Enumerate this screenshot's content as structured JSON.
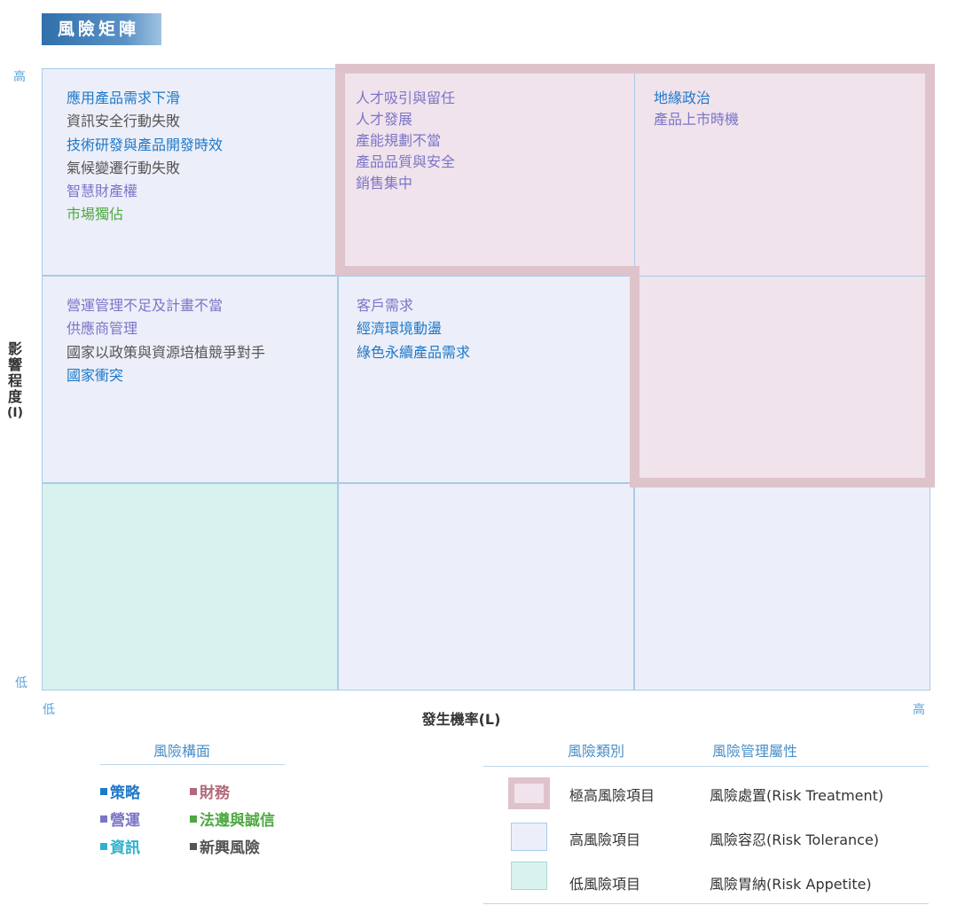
{
  "title": "風險矩陣",
  "axes": {
    "y_high": "高",
    "y_low": "低",
    "y_title_chars": [
      "影",
      "響",
      "程",
      "度",
      "(I)"
    ],
    "x_low": "低",
    "x_high": "高",
    "x_title": "發生機率(L)"
  },
  "colors": {
    "strategy": "#1f78c8",
    "finance": "#b2697a",
    "operations": "#7b75c8",
    "compliance": "#4ea843",
    "information": "#2eb2cc",
    "emerging": "#555555",
    "extreme_fill": "#f0e3ec",
    "extreme_border": "#dfc3cb",
    "high_fill": "#eceff9",
    "low_fill": "#d8f3ee"
  },
  "matrix": {
    "r0c0": [
      {
        "text": "應用產品需求下滑",
        "cat": "strategy"
      },
      {
        "text": "資訊安全行動失敗",
        "cat": "emerging"
      },
      {
        "text": "技術研發與產品開發時效",
        "cat": "strategy"
      },
      {
        "text": "氣候變遷行動失敗",
        "cat": "emerging"
      },
      {
        "text": "智慧財產權",
        "cat": "operations"
      },
      {
        "text": "市場獨佔",
        "cat": "compliance"
      }
    ],
    "r0c1": [
      {
        "text": "人才吸引與留任",
        "cat": "operations"
      },
      {
        "text": "人才發展",
        "cat": "operations"
      },
      {
        "text": "產能規劃不當",
        "cat": "operations"
      },
      {
        "text": "產品品質與安全",
        "cat": "operations"
      },
      {
        "text": "銷售集中",
        "cat": "operations"
      }
    ],
    "r0c2": [
      {
        "text": "地緣政治",
        "cat": "strategy"
      },
      {
        "text": "產品上市時機",
        "cat": "operations"
      }
    ],
    "r1c0": [
      {
        "text": "營運管理不足及計畫不當",
        "cat": "operations"
      },
      {
        "text": "供應商管理",
        "cat": "operations"
      },
      {
        "text": "國家以政策與資源培植競爭對手",
        "cat": "emerging"
      },
      {
        "text": "國家衝突",
        "cat": "strategy"
      }
    ],
    "r1c1": [
      {
        "text": "客戶需求",
        "cat": "operations"
      },
      {
        "text": "經濟環境動盪",
        "cat": "strategy"
      },
      {
        "text": "綠色永續產品需求",
        "cat": "strategy"
      }
    ]
  },
  "legend_left": {
    "heading": "風險構面",
    "items": [
      {
        "label": "策略",
        "cat": "strategy"
      },
      {
        "label": "財務",
        "cat": "finance"
      },
      {
        "label": "營運",
        "cat": "operations"
      },
      {
        "label": "法遵與誠信",
        "cat": "compliance"
      },
      {
        "label": "資訊",
        "cat": "information"
      },
      {
        "label": "新興風險",
        "cat": "emerging"
      }
    ]
  },
  "legend_right": {
    "heading_category": "風險類別",
    "heading_attribute": "風險管理屬性",
    "rows": [
      {
        "category": "極高風險項目",
        "attribute": "風險處置(Risk Treatment)"
      },
      {
        "category": "高風險項目",
        "attribute": "風險容忍(Risk Tolerance)"
      },
      {
        "category": "低風險項目",
        "attribute": "風險胃納(Risk Appetite)"
      }
    ]
  }
}
